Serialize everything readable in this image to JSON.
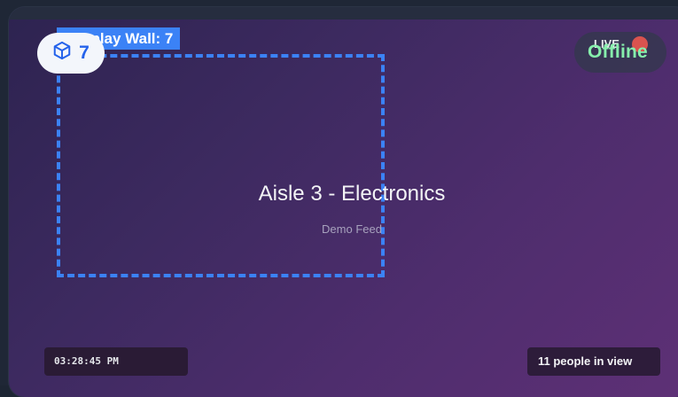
{
  "feed": {
    "title": "Aisle 3 - Electronics",
    "subtitle": "Demo Feed"
  },
  "detection": {
    "label": "Display Wall: 7"
  },
  "count_chip": {
    "icon": "cube-icon",
    "value": "7"
  },
  "status": {
    "live": "LIVE",
    "state": "Offline"
  },
  "footer": {
    "timestamp": "03:28:45 PM",
    "people": "11 people in view"
  },
  "colors": {
    "accent": "#3b82f6",
    "offline": "#86efac",
    "live_dot": "#d9534f"
  }
}
